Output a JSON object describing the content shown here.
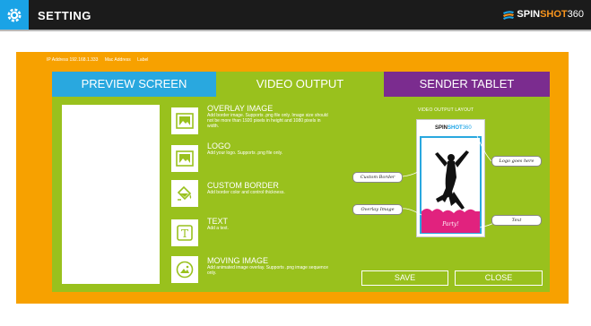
{
  "titlebar": {
    "title": "SETTING",
    "brand_spin": "SPIN",
    "brand_shot": "SHOT",
    "brand_num": "360"
  },
  "info": {
    "ip": "IP Address  192.168.1.333",
    "mac": "Mac Address",
    "label": "Label"
  },
  "tabs": [
    {
      "label": "PREVIEW SCREEN"
    },
    {
      "label": "VIDEO OUTPUT"
    },
    {
      "label": "SENDER TABLET"
    }
  ],
  "options": [
    {
      "title": "OVERLAY IMAGE",
      "desc": "Add border image. Supports .png file only. Image size should not be more than 1920 pixels in height and 1080 pixels in width.",
      "icon": "image-icon"
    },
    {
      "title": "LOGO",
      "desc": "Add your logo. Supports .png file only.",
      "icon": "logo-image-icon"
    },
    {
      "title": "CUSTOM BORDER",
      "desc": "Add border color and control thickness.",
      "icon": "paint-bucket-icon"
    },
    {
      "title": "TEXT",
      "desc": "Add a text.",
      "icon": "text-icon"
    },
    {
      "title": "MOVING IMAGE",
      "desc": "Add animated image overlay. Supports .png image sequence only.",
      "icon": "moving-image-icon"
    }
  ],
  "layout": {
    "label": "VIDEO OUTPUT LAYOUT",
    "phone_brand_spin": "SPIN",
    "phone_brand_shot": "SHOT",
    "phone_brand_num": "360",
    "party_text": "Party!",
    "callouts": {
      "custom_border": "Custom Border",
      "overlay_image": "Overlay Image",
      "logo": "Logo goes here",
      "text": "Text"
    }
  },
  "buttons": {
    "save": "SAVE",
    "close": "CLOSE"
  },
  "colors": {
    "titlebar": "#1b1b1b",
    "accent_blue": "#1aa3e6",
    "frame_orange": "#f7a100",
    "panel_green": "#99c11d",
    "tab_blue": "#29a8df",
    "tab_purple": "#7b2c8f",
    "party_pink": "#e1227e"
  }
}
